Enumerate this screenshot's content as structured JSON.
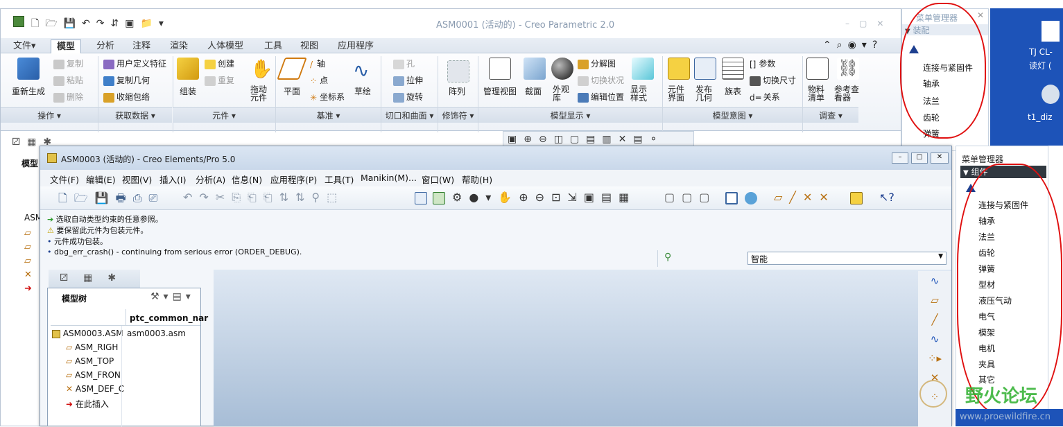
{
  "back_window": {
    "title": "ASM0001 (活动的) - Creo Parametric 2.0",
    "tabs": [
      "文件▾",
      "模型",
      "分析",
      "注释",
      "渲染",
      "人体模型",
      "工具",
      "视图",
      "应用程序"
    ],
    "ribbon": {
      "regen": "重新生成",
      "copy": "复制",
      "paste": "粘贴",
      "delete": "删除",
      "user_feature": "用户定义特征",
      "copy_geom": "复制几何",
      "shrinkwrap": "收缩包络",
      "assemble": "组装",
      "create": "创建",
      "repeat": "重复",
      "drag": "拖动元件",
      "plane": "平面",
      "axis": "轴",
      "point": "点",
      "csys": "坐标系",
      "sketch": "草绘",
      "hole": "孔",
      "extrude": "拉伸",
      "revolve": "旋转",
      "pattern": "阵列",
      "manage_view": "管理视图",
      "section": "截面",
      "appearance": "外观库",
      "explode": "分解图",
      "toggle_status": "切换状况",
      "edit_pos": "编辑位置",
      "display_style": "显示样式",
      "comp_interface": "元件界面",
      "publish_geom": "发布几何",
      "family_table": "族表",
      "params": "参数",
      "switch_dims": "切换尺寸",
      "relations": "关系",
      "bom": "物料清单",
      "ref_viewer": "参考查看器"
    },
    "groups": [
      "操作 ▾",
      "获取数据 ▾",
      "元件 ▾",
      "基准 ▾",
      "切口和曲面 ▾",
      "修饰符 ▾",
      "模型显示 ▾",
      "模型意图 ▾",
      "调查 ▾"
    ],
    "left_tree_label": "模型",
    "left_tree_asm": "ASM"
  },
  "front_window": {
    "title": "ASM0003 (活动的) - Creo Elements/Pro 5.0",
    "menus": [
      "文件(F)",
      "编辑(E)",
      "视图(V)",
      "插入(I)",
      "分析(A)",
      "信息(N)",
      "应用程序(P)",
      "工具(T)",
      "Manikin(M)...",
      "窗口(W)",
      "帮助(H)"
    ],
    "messages": [
      "选取自动类型约束的任意参照。",
      "要保留此元件为包装元件。",
      "元件成功包装。",
      "dbg_err_crash() - continuing from serious error (ORDER_DEBUG)."
    ],
    "filter_value": "智能",
    "model_tree_title": "模型树",
    "tree_column": "ptc_common_nar",
    "tree_items": [
      {
        "name": "ASM0003.ASM",
        "value": "asm0003.asm"
      },
      {
        "name": "ASM_RIGH",
        "value": ""
      },
      {
        "name": "ASM_TOP",
        "value": ""
      },
      {
        "name": "ASM_FRON",
        "value": ""
      },
      {
        "name": "ASM_DEF_C",
        "value": ""
      },
      {
        "name": "在此插入",
        "value": ""
      }
    ]
  },
  "menu_manager_top": {
    "title": "菜单管理器",
    "section": "装配",
    "items": [
      "连接与紧固件",
      "轴承",
      "法兰",
      "齿轮",
      "弹簧"
    ]
  },
  "menu_manager_right": {
    "title": "菜单管理器",
    "section": "组件",
    "items": [
      "连接与紧固件",
      "轴承",
      "法兰",
      "齿轮",
      "弹簧",
      "型材",
      "液压气动",
      "电气",
      "模架",
      "电机",
      "夹具",
      "其它"
    ]
  },
  "desktop": {
    "label1": "TJ CL-",
    "label2": "读灯 (",
    "label3": "t1_diz"
  },
  "watermark": {
    "text": "野火论坛",
    "url": "www.proewildfire.cn"
  },
  "colors": {
    "accent_red": "#e01010",
    "desktop_blue": "#1d53b8",
    "title_dark": "#303840"
  }
}
